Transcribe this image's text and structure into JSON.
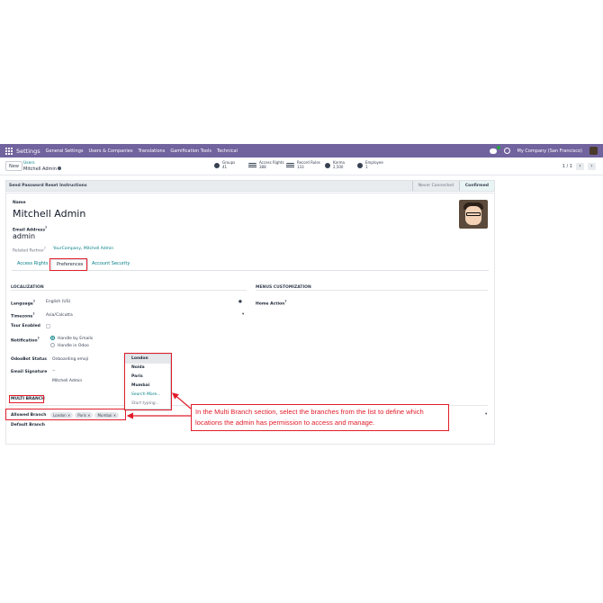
{
  "navbar": {
    "app_title": "Settings",
    "menus": [
      "General Settings",
      "Users & Companies",
      "Translations",
      "Gamification Tools",
      "Technical"
    ],
    "company": "My Company (San Francisco)"
  },
  "control": {
    "new_label": "New",
    "breadcrumb_parent": "Users",
    "breadcrumb_current": "Mitchell Admin",
    "stats": [
      {
        "label": "Groups",
        "value": "41"
      },
      {
        "label": "Access Rights",
        "value": "388"
      },
      {
        "label": "Record Rules",
        "value": "133"
      },
      {
        "label": "Karma",
        "value": "2,500"
      },
      {
        "label": "Employee",
        "value": "1"
      }
    ],
    "pager": "1 / 1"
  },
  "status": {
    "reset_button": "Send Password Reset Instructions",
    "stages": [
      "Never Connected",
      "Confirmed"
    ]
  },
  "form": {
    "name_label": "Name",
    "name_value": "Mitchell Admin",
    "email_label": "Email Address",
    "email_value": "admin",
    "related_partner_label": "Related Partner",
    "related_partner_value": "YourCompany, Mitchell Admin",
    "tabs": [
      "Access Rights",
      "Preferences",
      "Account Security"
    ],
    "localization": {
      "title": "LOCALIZATION",
      "language_label": "Language",
      "language_value": "English (US)",
      "timezone_label": "Timezone",
      "timezone_value": "Asia/Calcutta",
      "tour_label": "Tour Enabled",
      "notification_label": "Notification",
      "notification_options": [
        "Handle by Emails",
        "Handle in Odoo"
      ],
      "odoobot_label": "OdooBot Status",
      "odoobot_value": "Onboarding emoji",
      "signature_label": "Email Signature",
      "signature_lines": [
        "--",
        "Mitchell Admin"
      ]
    },
    "menus_customization": {
      "title": "MENUS CUSTOMIZATION",
      "home_action_label": "Home Action"
    },
    "multi_branch": {
      "title": "MULTI BRANCH",
      "allowed_label": "Allowed Branch",
      "allowed_tags": [
        "London",
        "Paris",
        "Mumbai"
      ],
      "default_label": "Default Branch"
    }
  },
  "dropdown": {
    "items": [
      "London",
      "Noida",
      "Paris",
      "Mumbai"
    ],
    "search_more": "Search More...",
    "start_typing": "Start typing..."
  },
  "callout": {
    "text": "In the Multi Branch section, select the branches from the list to define which locations the admin has permission to access and manage."
  },
  "colors": {
    "navbar": "#71639e",
    "link": "#017e84",
    "annotation": "#e11d2a"
  }
}
